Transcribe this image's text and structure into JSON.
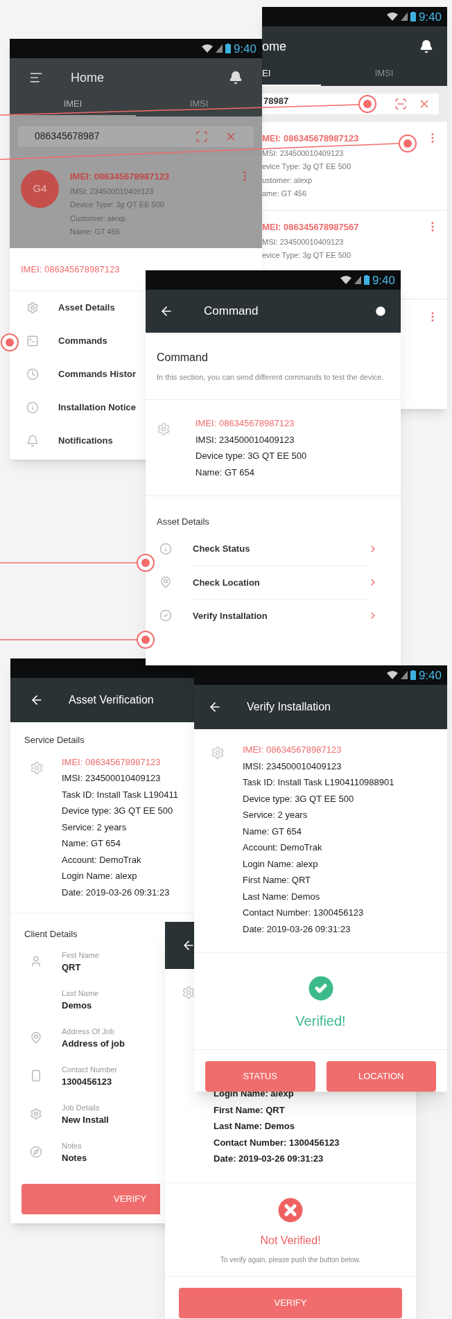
{
  "home_back": {
    "status_time": "9:40",
    "title": "ome",
    "tabs": [
      {
        "label": "EI",
        "selected": true
      },
      {
        "label": "IMSI",
        "selected": false
      }
    ],
    "search": {
      "value": "78987"
    },
    "items": [
      {
        "imei": "MEI: 086345678987123",
        "lines": [
          "MSI: 234500010409123",
          "evice Type: 3g QT EE 500",
          "ustomer: alexp",
          "ame: GT 456"
        ]
      },
      {
        "imei": "MEI: 086345678987567",
        "lines": [
          "MSI: 234500010409123",
          "evice Type: 3g QT EE 500"
        ]
      }
    ]
  },
  "home_menu": {
    "status_time": "9:40",
    "title": "Home",
    "tabs": [
      {
        "label": "IMEI",
        "selected": true
      },
      {
        "label": "IMSI",
        "selected": false
      }
    ],
    "search": {
      "value": "086345678987"
    },
    "item": {
      "avatar": "G4",
      "imei": "IMEI: 086345678987123",
      "lines": [
        "IMSI: 234500010409123",
        "Device Type: 3g QT EE 500",
        "Customer: alexp",
        "Name: GT 456"
      ]
    },
    "sheet": {
      "imei": "IMEI: 086345678987123",
      "menu": [
        "Asset Details",
        "Commands",
        "Commands Histor",
        "Installation Notice",
        "Notifications"
      ]
    }
  },
  "command": {
    "status_time": "9:40",
    "title": "Command",
    "heading": "Command",
    "description": "In this section, you can send different commands to test the device.",
    "device": {
      "imei": "IMEI: 086345678987123",
      "lines": [
        "IMSI: 234500010409123",
        "Device type: 3G QT EE 500",
        "Name: GT 654"
      ]
    },
    "section": "Asset Details",
    "actions": [
      "Check Status",
      "Check Location",
      "Verify Installation"
    ]
  },
  "asset_verification": {
    "title": "Asset Verification",
    "service_section": "Service Details",
    "imei": "IMEI: 086345678987123",
    "lines": [
      "IMSI: 234500010409123",
      "Task ID: Install Task L190411",
      "Device type: 3G QT EE 500",
      "Service: 2 years",
      "Name:  GT 654",
      "Account: DemoTrak",
      "Login Name: alexp",
      "Date: 2019-03-26 09:31:23"
    ],
    "client_section": "Client Details",
    "fields": [
      {
        "label": "First Name",
        "value": "QRT"
      },
      {
        "label": "Last Name",
        "value": "Demos"
      },
      {
        "label": "Address Of Job",
        "value": "Address of job"
      },
      {
        "label": "Contact Number",
        "value": "1300456123"
      },
      {
        "label": "Job Details",
        "value": "New Install"
      },
      {
        "label": "Notes",
        "value": "Notes"
      }
    ],
    "button": "VERIFY"
  },
  "verify_installation": {
    "status_time": "9:40",
    "title": "Verify Installation",
    "imei": "IMEI: 086345678987123",
    "lines": [
      "IMSI: 234500010409123",
      "Task ID: Install Task L1904110988901",
      "Device type: 3G QT EE 500",
      "Service: 2 years",
      "Name:  GT 654",
      "Account: DemoTrak",
      "Login Name: alexp",
      "First Name: QRT",
      "Last Name: Demos",
      "Contact Number: 1300456123",
      "Date: 2019-03-26 09:31:23"
    ],
    "verified": true,
    "result": "Verified!",
    "buttons": [
      "STATUS",
      "LOCATION"
    ]
  },
  "not_verified": {
    "lines": [
      "Login Name: alexp",
      "First Name: QRT",
      "Last Name: Demos",
      "Contact Number: 1300456123",
      "Date: 2019-03-26 09:31:23"
    ],
    "verified": false,
    "result": "Not Verified!",
    "hint": "To verify again, please push the button below.",
    "button": "VERIFY"
  }
}
